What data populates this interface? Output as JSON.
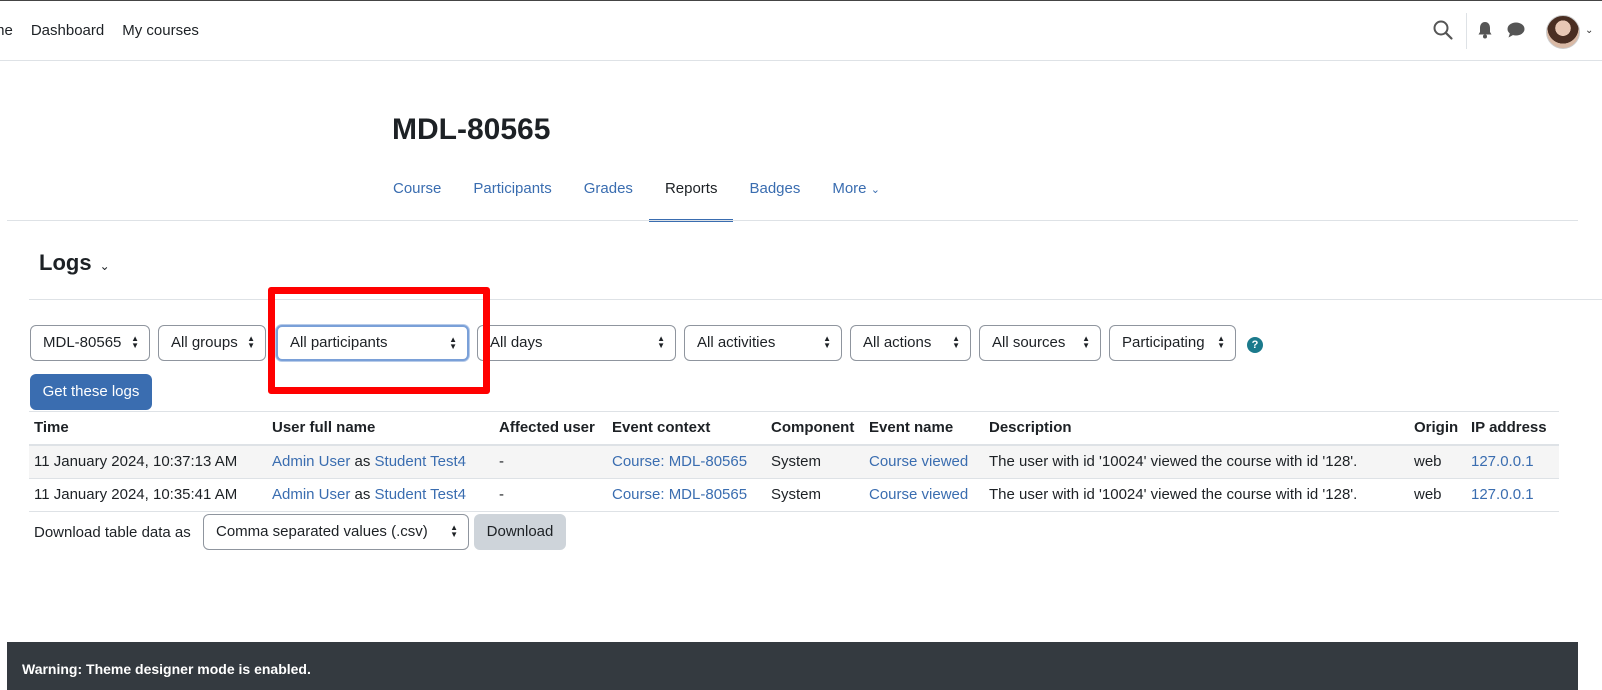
{
  "topnav": {
    "items": [
      "me",
      "Dashboard",
      "My courses"
    ]
  },
  "icons": {
    "search": "search-icon",
    "bell": "bell-icon",
    "chat": "chat-icon",
    "avatar": "user-avatar"
  },
  "course": {
    "title": "MDL-80565",
    "tabs": [
      "Course",
      "Participants",
      "Grades",
      "Reports",
      "Badges",
      "More"
    ],
    "active_tab": "Reports"
  },
  "logs": {
    "heading": "Logs",
    "filters": {
      "course": "MDL-80565",
      "groups": "All groups",
      "participants": "All participants",
      "days": "All days",
      "activities": "All activities",
      "actions": "All actions",
      "sources": "All sources",
      "edulevel": "Participating"
    },
    "help": "?",
    "get_logs_label": "Get these logs",
    "table": {
      "headers": [
        "Time",
        "User full name",
        "Affected user",
        "Event context",
        "Component",
        "Event name",
        "Description",
        "Origin",
        "IP address"
      ],
      "rows": [
        {
          "time": "11 January 2024, 10:37:13 AM",
          "user": "Admin User",
          "as": "as",
          "as_user": "Student Test4",
          "affected": "-",
          "context": "Course: MDL-80565",
          "component": "System",
          "event": "Course viewed",
          "description": "The user with id '10024' viewed the course with id '128'.",
          "origin": "web",
          "ip": "127.0.0.1"
        },
        {
          "time": "11 January 2024, 10:35:41 AM",
          "user": "Admin User",
          "as": "as",
          "as_user": "Student Test4",
          "affected": "-",
          "context": "Course: MDL-80565",
          "component": "System",
          "event": "Course viewed",
          "description": "The user with id '10024' viewed the course with id '128'.",
          "origin": "web",
          "ip": "127.0.0.1"
        }
      ]
    },
    "download": {
      "label": "Download table data as",
      "format": "Comma separated values (.csv)",
      "button": "Download"
    }
  },
  "footer": {
    "warning": "Warning: Theme designer mode is enabled."
  },
  "colors": {
    "link": "#3a6db0",
    "highlight": "#ff0000",
    "footer_bg": "#343a40"
  }
}
